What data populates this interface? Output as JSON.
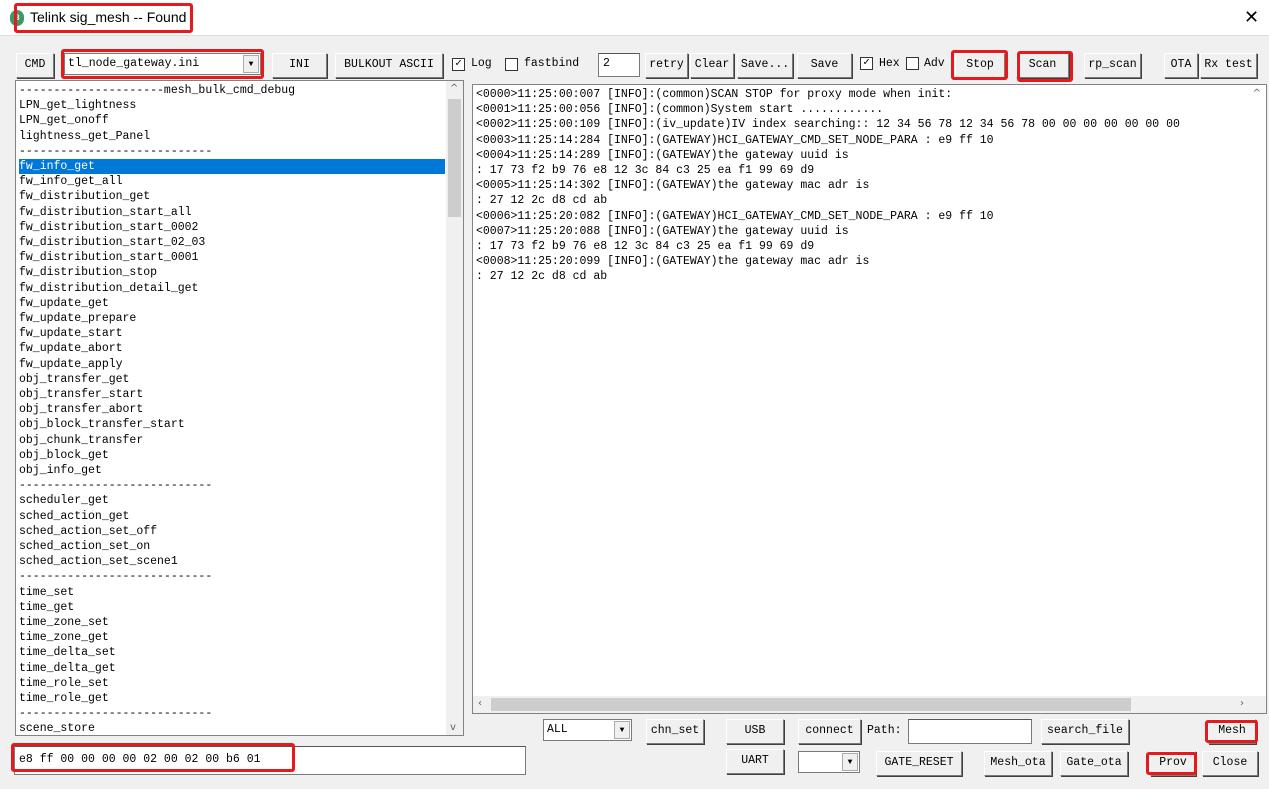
{
  "window": {
    "title": "Telink sig_mesh -- Found",
    "close_icon": "close-icon"
  },
  "toolbar": {
    "cmd": "CMD",
    "ini_file": "tl_node_gateway.ini",
    "ini": "INI",
    "bulkout": "BULKOUT ASCII",
    "log_label": "Log",
    "log_checked": true,
    "fastbind_label": "fastbind",
    "fastbind_checked": false,
    "retry_value": "2",
    "retry": "retry",
    "clear": "Clear",
    "save_as": "Save...",
    "save": "Save",
    "hex_label": "Hex",
    "hex_checked": true,
    "adv_label": "Adv",
    "adv_checked": false,
    "stop": "Stop",
    "scan": "Scan",
    "rp_scan": "rp_scan",
    "ota": "OTA",
    "rx_test": "Rx test"
  },
  "command_list": {
    "selected_index": 5,
    "items": [
      "---------------------mesh_bulk_cmd_debug",
      "LPN_get_lightness",
      "LPN_get_onoff",
      "lightness_get_Panel",
      "----------------------------",
      "fw_info_get",
      "fw_info_get_all",
      "fw_distribution_get",
      "fw_distribution_start_all",
      "fw_distribution_start_0002",
      "fw_distribution_start_02_03",
      "fw_distribution_start_0001",
      "fw_distribution_stop",
      "fw_distribution_detail_get",
      "fw_update_get",
      "fw_update_prepare",
      "fw_update_start",
      "fw_update_abort",
      "fw_update_apply",
      "obj_transfer_get",
      "obj_transfer_start",
      "obj_transfer_abort",
      "obj_block_transfer_start",
      "obj_chunk_transfer",
      "obj_block_get",
      "obj_info_get",
      "----------------------------",
      "scheduler_get",
      "sched_action_get",
      "sched_action_set_off",
      "sched_action_set_on",
      "sched_action_set_scene1",
      "----------------------------",
      "time_set",
      "time_get",
      "time_zone_set",
      "time_zone_get",
      "time_delta_set",
      "time_delta_get",
      "time_role_set",
      "time_role_get",
      "----------------------------",
      "scene_store"
    ]
  },
  "log": {
    "lines": [
      "<0000>11:25:00:007 [INFO]:(common)SCAN STOP for proxy mode when init:",
      "<0001>11:25:00:056 [INFO]:(common)System start ............",
      "<0002>11:25:00:109 [INFO]:(iv_update)IV index searching:: 12 34 56 78 12 34 56 78 00 00 00 00 00 00 00",
      "<0003>11:25:14:284 [INFO]:(GATEWAY)HCI_GATEWAY_CMD_SET_NODE_PARA : e9 ff 10",
      "<0004>11:25:14:289 [INFO]:(GATEWAY)the gateway uuid is",
      ": 17 73 f2 b9 76 e8 12 3c 84 c3 25 ea f1 99 69 d9",
      "<0005>11:25:14:302 [INFO]:(GATEWAY)the gateway mac adr is",
      ": 27 12 2c d8 cd ab",
      "<0006>11:25:20:082 [INFO]:(GATEWAY)HCI_GATEWAY_CMD_SET_NODE_PARA : e9 ff 10",
      "<0007>11:25:20:088 [INFO]:(GATEWAY)the gateway uuid is",
      ": 17 73 f2 b9 76 e8 12 3c 84 c3 25 ea f1 99 69 d9",
      "<0008>11:25:20:099 [INFO]:(GATEWAY)the gateway mac adr is",
      ": 27 12 2c d8 cd ab"
    ]
  },
  "command_input": {
    "value": "e8 ff 00 00 00 00 02 00 02 00 b6 01"
  },
  "bottom": {
    "channel": "ALL",
    "chn_set": "chn_set",
    "usb": "USB",
    "connect": "connect",
    "path_label": "Path:",
    "path_value": "",
    "search_file": "search_file",
    "mesh": "Mesh",
    "uart": "UART",
    "port": "",
    "gate_reset": "GATE_RESET",
    "mesh_ota": "Mesh_ota",
    "gate_ota": "Gate_ota",
    "prov": "Prov",
    "close": "Close"
  },
  "colors": {
    "highlight": "#e8191d",
    "selection": "#0078d7"
  }
}
